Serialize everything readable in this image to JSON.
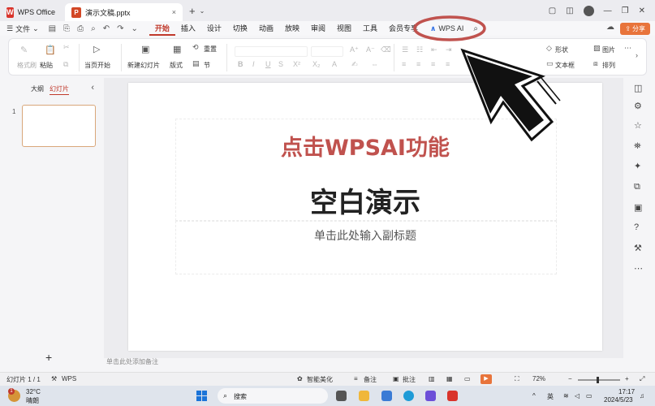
{
  "titlebar": {
    "home_tab": "WPS Office",
    "doc_tab": "演示文稿.pptx",
    "close": "×",
    "new_tab": "+",
    "more": "⌄"
  },
  "menubar": {
    "file": "文件",
    "tabs": [
      {
        "label": "开始",
        "active": true
      },
      {
        "label": "插入"
      },
      {
        "label": "设计"
      },
      {
        "label": "切换"
      },
      {
        "label": "动画"
      },
      {
        "label": "放映"
      },
      {
        "label": "审阅"
      },
      {
        "label": "视图"
      },
      {
        "label": "工具"
      },
      {
        "label": "会员专享"
      }
    ],
    "wps_ai": "WPS AI",
    "share": "分享"
  },
  "ribbon": {
    "format_painter": "格式刷",
    "paste": "粘贴",
    "play_from_current": "当页开始",
    "new_slide": "新建幻灯片",
    "layout": "版式",
    "section": "节",
    "reset": "重置",
    "shape": "形状",
    "textbox": "文本框",
    "picture": "图片",
    "arrange": "排列"
  },
  "leftpanel": {
    "outline_tab": "大纲",
    "slides_tab": "幻灯片",
    "slide_number": "1",
    "add": "+"
  },
  "slide": {
    "overlay_caption": "点击WPSAI功能",
    "title": "空白演示",
    "subtitle": "单击此处输入副标题"
  },
  "notes_placeholder": "单击此处添加备注",
  "statusbar": {
    "slide_count": "幻灯片 1 / 1",
    "wps": "WPS",
    "beautify": "智能美化",
    "notes": "备注",
    "comments": "批注",
    "zoom": "72%",
    "zoom_level": 0.45
  },
  "taskbar": {
    "temperature": "32°C",
    "weather": "晴朗",
    "search": "搜索",
    "ime": "英",
    "time": "17:17",
    "date": "2024/5/23"
  },
  "colors": {
    "accent": "#c0392b",
    "share": "#e8743b",
    "annotation_circle": "#c0524e"
  }
}
